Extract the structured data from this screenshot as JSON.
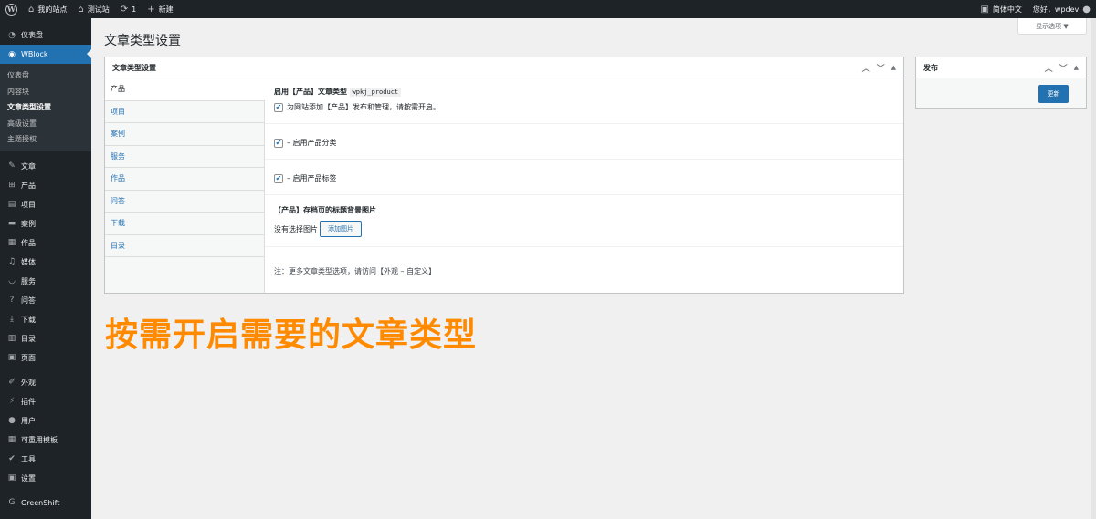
{
  "adminbar": {
    "site_name": "我的站点",
    "test_site": "测试站",
    "updates_count": "1",
    "new_label": "新建",
    "language": "简体中文",
    "greeting": "您好，wpdev"
  },
  "sidebar": {
    "dashboard": "仪表盘",
    "wblock": "WBlock",
    "submenu": [
      "仪表盘",
      "内容块",
      "文章类型设置",
      "高级设置",
      "主题授权"
    ],
    "items": [
      "文章",
      "产品",
      "项目",
      "案例",
      "作品",
      "媒体",
      "服务",
      "问答",
      "下载",
      "目录",
      "页面"
    ],
    "items2": [
      "外观",
      "插件",
      "用户",
      "可重用模板",
      "工具",
      "设置"
    ],
    "greenshift": "GreenShift"
  },
  "page": {
    "title": "文章类型设置",
    "screen_options": "显示选项 ▼"
  },
  "settings_box": {
    "title": "文章类型设置",
    "tabs": [
      "产品",
      "项目",
      "案例",
      "服务",
      "作品",
      "问答",
      "下载",
      "目录"
    ],
    "enable_label": "启用【产品】文章类型",
    "post_type_code": "wpkj_product",
    "enable_desc": "为网站添加【产品】发布和管理，请按需开启。",
    "enable_category": "– 启用产品分类",
    "enable_tag": "– 启用产品标签",
    "archive_bg_label": "【产品】存档页的标题背景图片",
    "no_image": "没有选择图片",
    "add_image": "添加图片",
    "note": "注：更多文章类型选项，请访问【外观 – 自定义】"
  },
  "publish_box": {
    "title": "发布",
    "update_button": "更新"
  },
  "overlay_text": "按需开启需要的文章类型"
}
